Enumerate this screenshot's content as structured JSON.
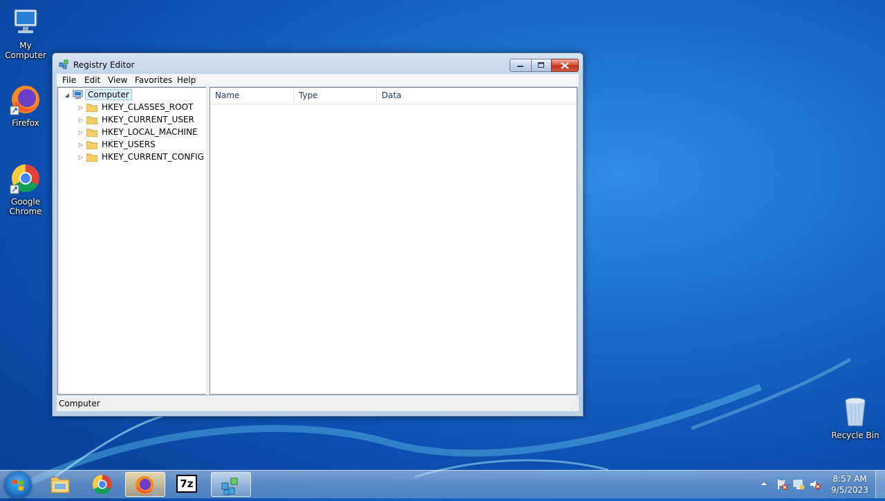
{
  "desktop": {
    "icons": [
      {
        "name": "my-computer",
        "label": "My\nComputer",
        "label_line1": "My",
        "label_line2": "Computer"
      },
      {
        "name": "firefox",
        "label": "Firefox"
      },
      {
        "name": "google-chrome",
        "label_line1": "Google",
        "label_line2": "Chrome"
      },
      {
        "name": "recycle-bin",
        "label": "Recycle Bin"
      }
    ]
  },
  "window": {
    "title": "Registry Editor",
    "menu": [
      "File",
      "Edit",
      "View",
      "Favorites",
      "Help"
    ],
    "tree": {
      "root": "Computer",
      "keys": [
        "HKEY_CLASSES_ROOT",
        "HKEY_CURRENT_USER",
        "HKEY_LOCAL_MACHINE",
        "HKEY_USERS",
        "HKEY_CURRENT_CONFIG"
      ]
    },
    "list_columns": [
      "Name",
      "Type",
      "Data"
    ],
    "status": "Computer"
  },
  "taskbar": {
    "apps": [
      "explorer-icon",
      "chrome-icon",
      "firefox-icon",
      "7zip-icon",
      "regedit-icon"
    ],
    "sevenzip_label": "7z",
    "clock": {
      "time": "8:57 AM",
      "date": "9/5/2023"
    }
  },
  "colors": {
    "desktop": "#1a69c9",
    "close_button": "#c0321c"
  }
}
